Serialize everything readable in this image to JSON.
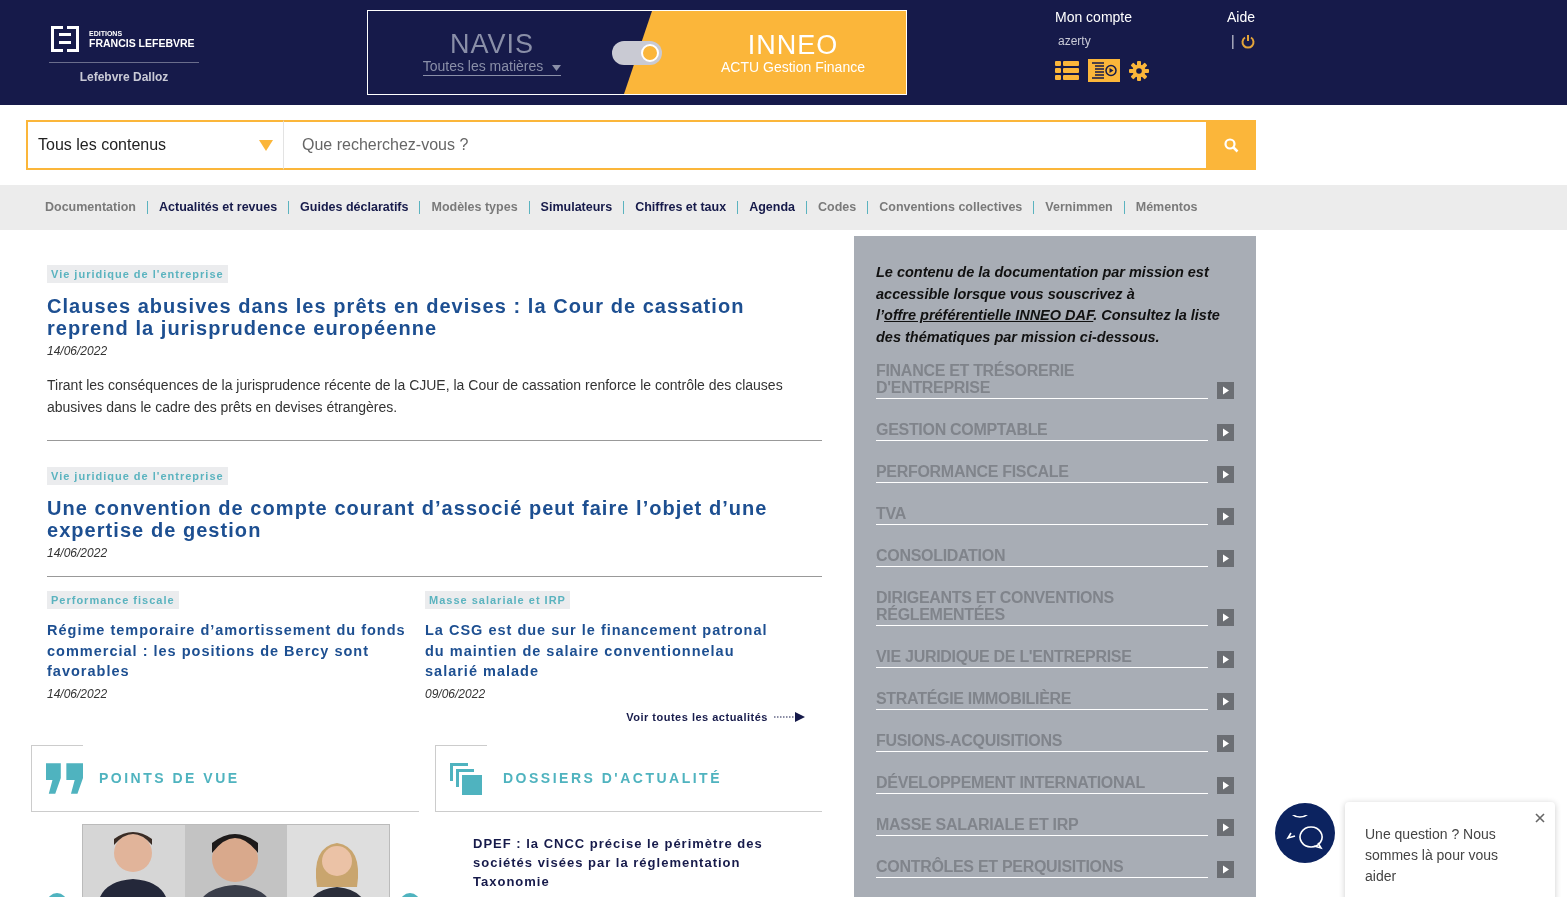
{
  "header": {
    "logo": {
      "line1": "EDITIONS",
      "line2": "FRANCIS LEFEBVRE",
      "line3": "Lefebvre Dalloz"
    },
    "products": [
      {
        "name": "NAVIS",
        "subtitle": "Toutes les matières",
        "selected": false
      },
      {
        "name": "INNEO",
        "subtitle": "ACTU Gestion Finance",
        "selected": true
      }
    ],
    "switch": {
      "on": true
    },
    "account": {
      "label": "Mon compte",
      "user": "azerty"
    },
    "help": {
      "label": "Aide",
      "separator": "|"
    }
  },
  "search": {
    "scope": "Tous les contenus",
    "placeholder": "Que recherchez-vous ?"
  },
  "nav": [
    {
      "label": "Documentation",
      "available": false
    },
    {
      "label": "Actualités et revues",
      "available": true
    },
    {
      "label": "Guides déclaratifs",
      "available": true
    },
    {
      "label": "Modèles types",
      "available": false
    },
    {
      "label": "Simulateurs",
      "available": true
    },
    {
      "label": "Chiffres et taux",
      "available": true
    },
    {
      "label": "Agenda",
      "available": true
    },
    {
      "label": "Codes",
      "available": false
    },
    {
      "label": "Conventions collectives",
      "available": false
    },
    {
      "label": "Vernimmen",
      "available": false
    },
    {
      "label": "Mémentos",
      "available": false
    }
  ],
  "featured": [
    {
      "topic": "Vie juridique de l'entreprise",
      "title": "Clauses abusives dans les prêts en devises : la Cour de cassation reprend la jurisprudence européenne",
      "date": "14/06/2022",
      "summary": "Tirant les conséquences de la jurisprudence récente de la CJUE, la Cour de cassation renforce le contrôle des clauses abusives dans le cadre des prêts en devises étrangères."
    },
    {
      "topic": "Vie juridique de l'entreprise",
      "title": "Une convention de compte courant d’associé peut faire l’objet d’une expertise de gestion",
      "date": "14/06/2022"
    }
  ],
  "columns": [
    {
      "topic": "Performance fiscale",
      "title": "Régime temporaire d’amortissement du fonds commercial : les positions de Bercy sont favorables",
      "date": "14/06/2022"
    },
    {
      "topic": "Masse salariale et IRP",
      "title": "La CSG est due sur le financement patronal du maintien de salaire conventionnelau salarié malade",
      "date": "09/06/2022"
    }
  ],
  "see_all": "Voir toutes les actualités",
  "sections": [
    {
      "kind": "quote",
      "title": "POINTS DE VUE"
    },
    {
      "kind": "stack",
      "title": "DOSSIERS D'ACTUALITÉ",
      "item": "DPEF : la CNCC précise le périmètre des sociétés visées par la réglementation Taxonomie"
    }
  ],
  "mission_panel": {
    "intro_before": "Le contenu de la documentation par mission est accessible lorsque vous souscrivez à l’",
    "link": "offre préférentielle INNEO DAF",
    "intro_after": ". Consultez la liste des thématiques par mission ci-dessous.",
    "items": [
      "FINANCE ET TRÉSORERIE D'ENTREPRISE",
      "GESTION COMPTABLE",
      "PERFORMANCE FISCALE",
      "TVA",
      "CONSOLIDATION",
      "DIRIGEANTS ET CONVENTIONS RÉGLEMENTÉES",
      "VIE JURIDIQUE DE L'ENTREPRISE",
      "STRATÉGIE IMMOBILIÈRE",
      "FUSIONS-ACQUISITIONS",
      "DÉVELOPPEMENT INTERNATIONAL",
      "MASSE SALARIALE ET IRP",
      "CONTRÔLES ET PERQUISITIONS"
    ]
  },
  "chat": {
    "message": "Une question ? Nous sommes là pour vous aider"
  }
}
